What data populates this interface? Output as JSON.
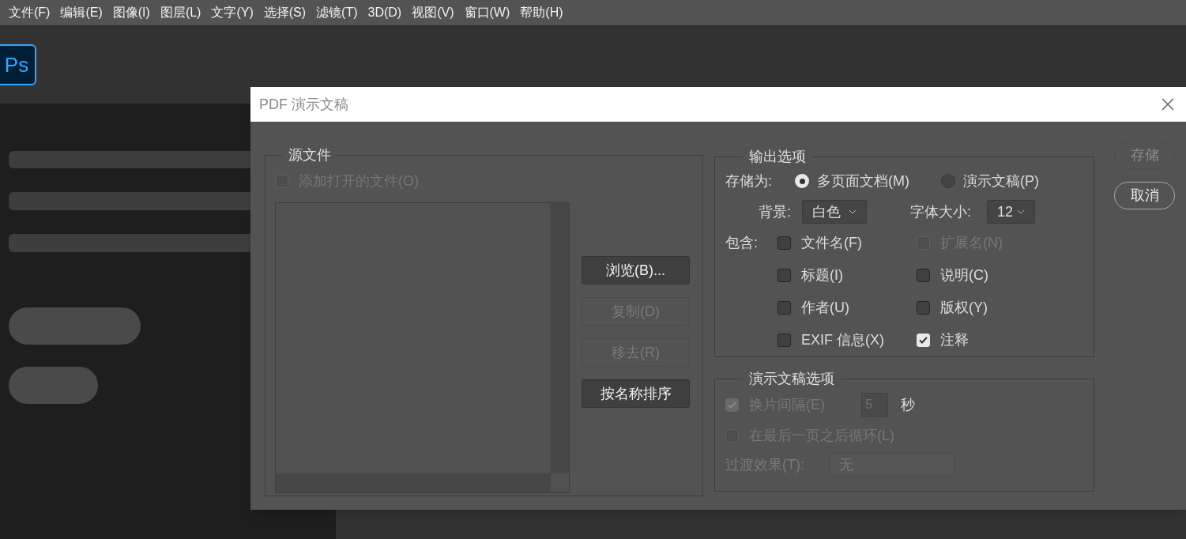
{
  "menu": [
    {
      "label": "文件(F)"
    },
    {
      "label": "编辑(E)"
    },
    {
      "label": "图像(I)"
    },
    {
      "label": "图层(L)"
    },
    {
      "label": "文字(Y)"
    },
    {
      "label": "选择(S)"
    },
    {
      "label": "滤镜(T)"
    },
    {
      "label": "3D(D)"
    },
    {
      "label": "视图(V)"
    },
    {
      "label": "窗口(W)"
    },
    {
      "label": "帮助(H)"
    }
  ],
  "app_logo": {
    "label": "Ps"
  },
  "dialog": {
    "title": "PDF 演示文稿",
    "source_files": {
      "legend": "源文件",
      "add_open_files": {
        "label": "添加打开的文件(O)",
        "checked": false,
        "disabled": true
      },
      "buttons": [
        {
          "label": "浏览(B)...",
          "disabled": false
        },
        {
          "label": "复制(D)",
          "disabled": true
        },
        {
          "label": "移去(R)",
          "disabled": true
        },
        {
          "label": "按名称排序",
          "disabled": false
        }
      ]
    },
    "output_options": {
      "legend": "输出选项",
      "save_as_label": "存储为:",
      "save_as": [
        {
          "label": "多页面文档(M)",
          "selected": true
        },
        {
          "label": "演示文稿(P)",
          "selected": false
        }
      ],
      "background_label": "背景:",
      "background_value": "白色",
      "font_size_label": "字体大小:",
      "font_size_value": "12",
      "include_label": "包含:",
      "include": [
        {
          "label": "文件名(F)",
          "checked": false,
          "disabled": false
        },
        {
          "label": "扩展名(N)",
          "checked": false,
          "disabled": true
        },
        {
          "label": "标题(I)",
          "checked": false,
          "disabled": false
        },
        {
          "label": "说明(C)",
          "checked": false,
          "disabled": false
        },
        {
          "label": "作者(U)",
          "checked": false,
          "disabled": false
        },
        {
          "label": "版权(Y)",
          "checked": false,
          "disabled": false
        },
        {
          "label": "EXIF 信息(X)",
          "checked": false,
          "disabled": false
        },
        {
          "label": "注释",
          "checked": true,
          "disabled": false
        }
      ]
    },
    "presentation_options": {
      "legend": "演示文稿选项",
      "advance": {
        "label": "换片间隔(E)",
        "checked": true,
        "disabled": true
      },
      "interval_value": "5",
      "seconds_label": "秒",
      "loop": {
        "label": "在最后一页之后循环(L)",
        "checked": false,
        "disabled": true
      },
      "transition_label": "过渡效果(T):",
      "transition_value": "无"
    },
    "side_buttons": [
      {
        "label": "存储",
        "disabled": true
      },
      {
        "label": "取消",
        "disabled": false
      }
    ]
  }
}
